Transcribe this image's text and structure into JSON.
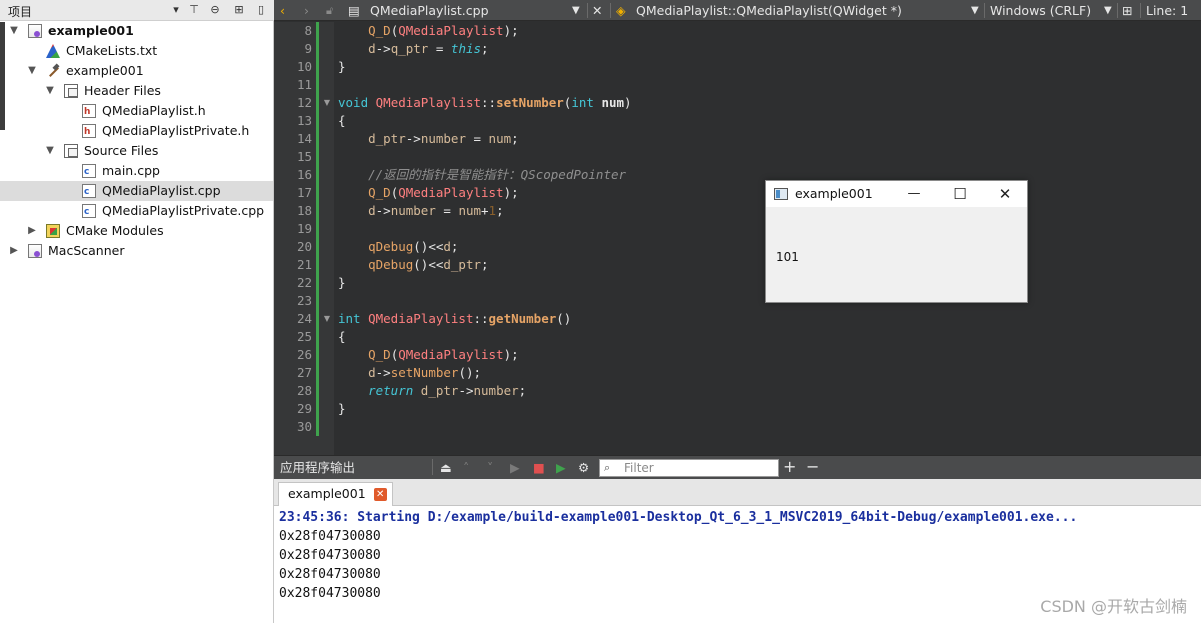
{
  "project_panel": {
    "title": "项目",
    "toolbar_icons": [
      "dropdown-icon",
      "filter-icon",
      "link-icon",
      "split-icon",
      "close-panel-icon"
    ],
    "tree": [
      {
        "label": "example001",
        "bold": true,
        "expanded": true,
        "icon": "qt-project-icon",
        "depth": 0
      },
      {
        "label": "CMakeLists.txt",
        "icon": "cmake-file-icon",
        "depth": 1
      },
      {
        "label": "example001",
        "expanded": true,
        "icon": "build-target-icon",
        "depth": 1
      },
      {
        "label": "Header Files",
        "expanded": true,
        "icon": "folder-icon",
        "depth": 2
      },
      {
        "label": "QMediaPlaylist.h",
        "icon": "header-file-icon",
        "depth": 3
      },
      {
        "label": "QMediaPlaylistPrivate.h",
        "icon": "header-file-icon",
        "depth": 3
      },
      {
        "label": "Source Files",
        "expanded": true,
        "icon": "folder-icon",
        "depth": 2
      },
      {
        "label": "main.cpp",
        "icon": "cpp-file-icon",
        "depth": 3
      },
      {
        "label": "QMediaPlaylist.cpp",
        "icon": "cpp-file-icon",
        "depth": 3,
        "selected": true
      },
      {
        "label": "QMediaPlaylistPrivate.cpp",
        "icon": "cpp-file-icon",
        "depth": 3
      },
      {
        "label": "CMake Modules",
        "expanded": false,
        "icon": "cmake-folder-icon",
        "depth": 1
      },
      {
        "label": "MacScanner",
        "expanded": false,
        "icon": "qt-project-icon",
        "depth": 0
      }
    ]
  },
  "editor_toolbar": {
    "file_name": "QMediaPlaylist.cpp",
    "symbol": "QMediaPlaylist::QMediaPlaylist(QWidget *)",
    "line_endings": "Windows (CRLF)",
    "cursor_pos": "Line: 1"
  },
  "editor": {
    "line_numbers": [
      "8",
      "9",
      "10",
      "11",
      "12",
      "13",
      "14",
      "15",
      "16",
      "17",
      "18",
      "19",
      "20",
      "21",
      "22",
      "23",
      "24",
      "25",
      "26",
      "27",
      "28",
      "29",
      "30"
    ],
    "comment_text": "//返回的指针是智能指针：QScopedPointer"
  },
  "output_toolbar": {
    "title": "应用程序输出",
    "filter_placeholder": "Filter"
  },
  "output": {
    "tab_label": "example001",
    "start_line": "23:45:36: Starting D:/example/build-example001-Desktop_Qt_6_3_1_MSVC2019_64bit-Debug/example001.exe...",
    "lines": [
      "0x28f04730080",
      "0x28f04730080",
      "0x28f04730080",
      "0x28f04730080"
    ],
    "watermark": "CSDN @开软古剑楠"
  },
  "app_window": {
    "title": "example001",
    "label": "101"
  },
  "colors": {
    "editor_bg": "#2e2f30",
    "toolbar_bg": "#4a4b4c",
    "keyword": "#45c6d6",
    "class_name": "#ff8080",
    "output_start": "#1a2f9e"
  }
}
